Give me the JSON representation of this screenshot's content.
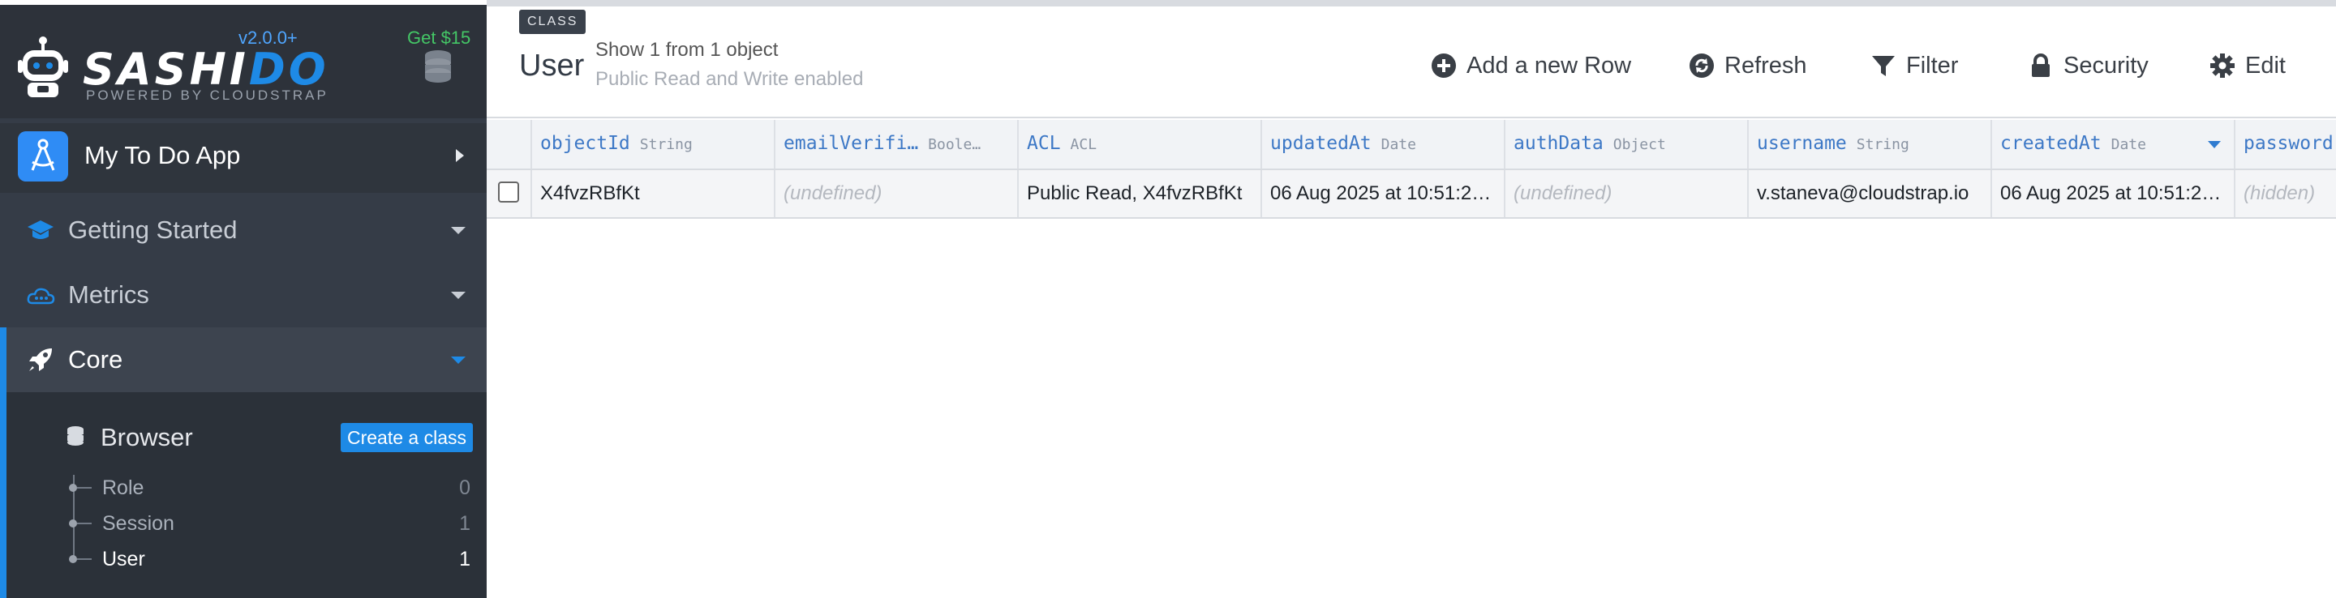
{
  "brand": {
    "name_main": "SASHI",
    "name_accent": "DO",
    "powered_by": "POWERED BY CLOUDSTRAP",
    "version": "v2.0.0+",
    "promo": "Get $15"
  },
  "app": {
    "name": "My To Do App"
  },
  "nav": [
    {
      "label": "Getting Started",
      "icon": "graduation-cap-icon"
    },
    {
      "label": "Metrics",
      "icon": "cloud-icon"
    },
    {
      "label": "Core",
      "icon": "rocket-icon",
      "active": true
    }
  ],
  "browser": {
    "label": "Browser",
    "create_label": "Create a class",
    "classes": [
      {
        "name": "Role",
        "count": "0"
      },
      {
        "name": "Session",
        "count": "1"
      },
      {
        "name": "User",
        "count": "1",
        "active": true
      }
    ]
  },
  "header": {
    "tag": "CLASS",
    "class_name": "User",
    "count_text": "Show 1 from 1 object",
    "permission_text": "Public Read and Write enabled",
    "tools": {
      "add_row": "Add a new Row",
      "refresh": "Refresh",
      "filter": "Filter",
      "security": "Security",
      "edit": "Edit"
    }
  },
  "grid": {
    "columns": [
      {
        "name": "objectId",
        "type": "String"
      },
      {
        "name": "emailVerifi…",
        "type": "Boole…"
      },
      {
        "name": "ACL",
        "type": "ACL"
      },
      {
        "name": "updatedAt",
        "type": "Date"
      },
      {
        "name": "authData",
        "type": "Object"
      },
      {
        "name": "username",
        "type": "String"
      },
      {
        "name": "createdAt",
        "type": "Date"
      },
      {
        "name": "password",
        "type": ""
      }
    ],
    "rows": [
      [
        "X4fvzRBfKt",
        "(undefined)",
        "Public Read, X4fvzRBfKt",
        "06 Aug 2025 at 10:51:2…",
        "(undefined)",
        "v.staneva@cloudstrap.io",
        "06 Aug 2025 at 10:51:2…",
        "(hidden)"
      ]
    ]
  },
  "colors": {
    "accent": "#1e8ae6",
    "sidebar": "#353c47",
    "promo": "#44c766",
    "column_header": "#3d78c6"
  }
}
